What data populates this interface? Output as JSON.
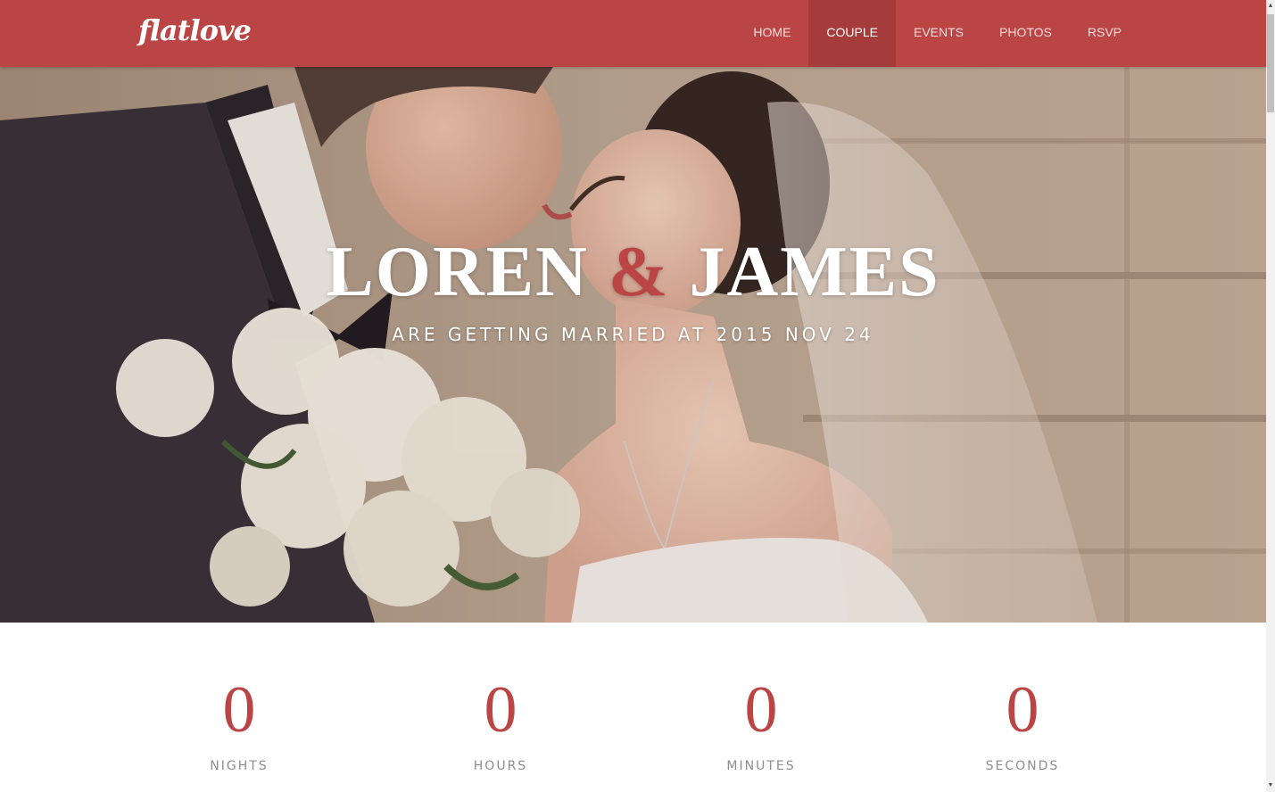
{
  "brand": {
    "logo": "flatlove",
    "accent_color": "#bb4545"
  },
  "nav": {
    "items": [
      {
        "label": "HOME",
        "active": false
      },
      {
        "label": "COUPLE",
        "active": true
      },
      {
        "label": "EVENTS",
        "active": false
      },
      {
        "label": "PHOTOS",
        "active": false
      },
      {
        "label": "RSVP",
        "active": false
      }
    ]
  },
  "hero": {
    "name_left": "LOREN",
    "ampersand": "&",
    "name_right": "JAMES",
    "subtitle": "ARE GETTING MARRIED AT 2015 NOV 24",
    "image": "wedding-couple-photo"
  },
  "countdown": {
    "items": [
      {
        "value": "0",
        "label": "NIGHTS"
      },
      {
        "value": "0",
        "label": "HOURS"
      },
      {
        "value": "0",
        "label": "MINUTES"
      },
      {
        "value": "0",
        "label": "SECONDS"
      }
    ]
  }
}
